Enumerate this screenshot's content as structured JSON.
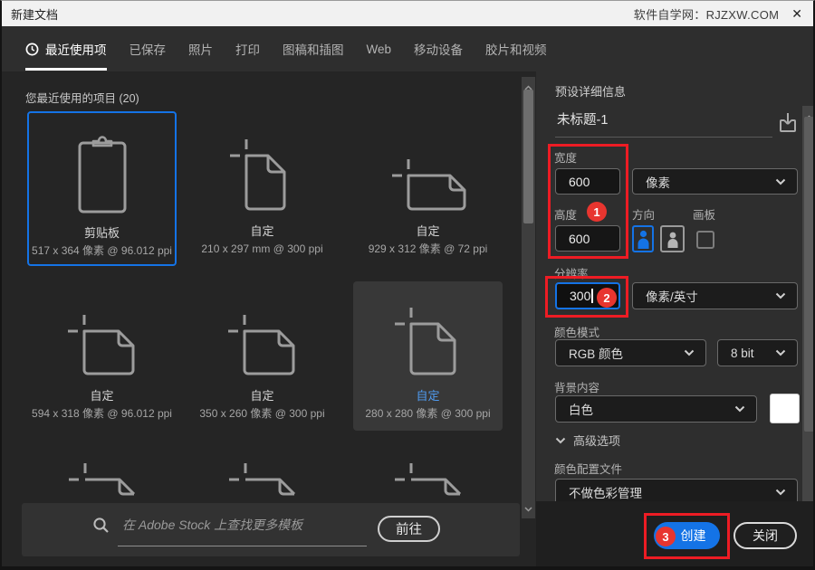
{
  "titlebar": {
    "title": "新建文档",
    "site": "软件自学网：RJZXW.COM",
    "close_label": "✕"
  },
  "tabs": [
    {
      "label": "最近使用项"
    },
    {
      "label": "已保存"
    },
    {
      "label": "照片"
    },
    {
      "label": "打印"
    },
    {
      "label": "图稿和插图"
    },
    {
      "label": "Web"
    },
    {
      "label": "移动设备"
    },
    {
      "label": "胶片和视频"
    }
  ],
  "recent": {
    "header": "您最近使用的项目 (20)",
    "items": [
      {
        "name": "剪贴板",
        "dims": "517 x 364 像素 @ 96.012 ppi"
      },
      {
        "name": "自定",
        "dims": "210 x 297 mm @ 300 ppi"
      },
      {
        "name": "自定",
        "dims": "929 x 312 像素 @ 72 ppi"
      },
      {
        "name": "自定",
        "dims": "594 x 318 像素 @ 96.012 ppi"
      },
      {
        "name": "自定",
        "dims": "350 x 260 像素 @ 300 ppi"
      },
      {
        "name": "自定",
        "dims": "280 x 280 像素 @ 300 ppi"
      }
    ]
  },
  "stock_search": {
    "placeholder": "在 Adobe Stock 上查找更多模板",
    "go_label": "前往"
  },
  "preset": {
    "header": "预设详细信息",
    "doc_name": "未标题-1",
    "width_label": "宽度",
    "width_value": "600",
    "unit_value": "像素",
    "height_label": "高度",
    "height_value": "600",
    "orientation_label": "方向",
    "artboard_label": "画板",
    "resolution_label": "分辨率",
    "resolution_value": "300",
    "resolution_unit": "像素/英寸",
    "color_mode_label": "颜色模式",
    "color_mode_value": "RGB 颜色",
    "bit_depth_value": "8 bit",
    "background_label": "背景内容",
    "background_value": "白色",
    "advanced_label": "高级选项",
    "profile_label": "颜色配置文件",
    "profile_value": "不做色彩管理"
  },
  "actions": {
    "create_label": "创建",
    "close_label": "关闭"
  },
  "annotations": {
    "step1": "1",
    "step2": "2",
    "step3": "3"
  },
  "colors": {
    "accent_blue": "#1473e6",
    "annotation_red": "#ed1c24",
    "hover_link_blue": "#4f9bf0"
  }
}
